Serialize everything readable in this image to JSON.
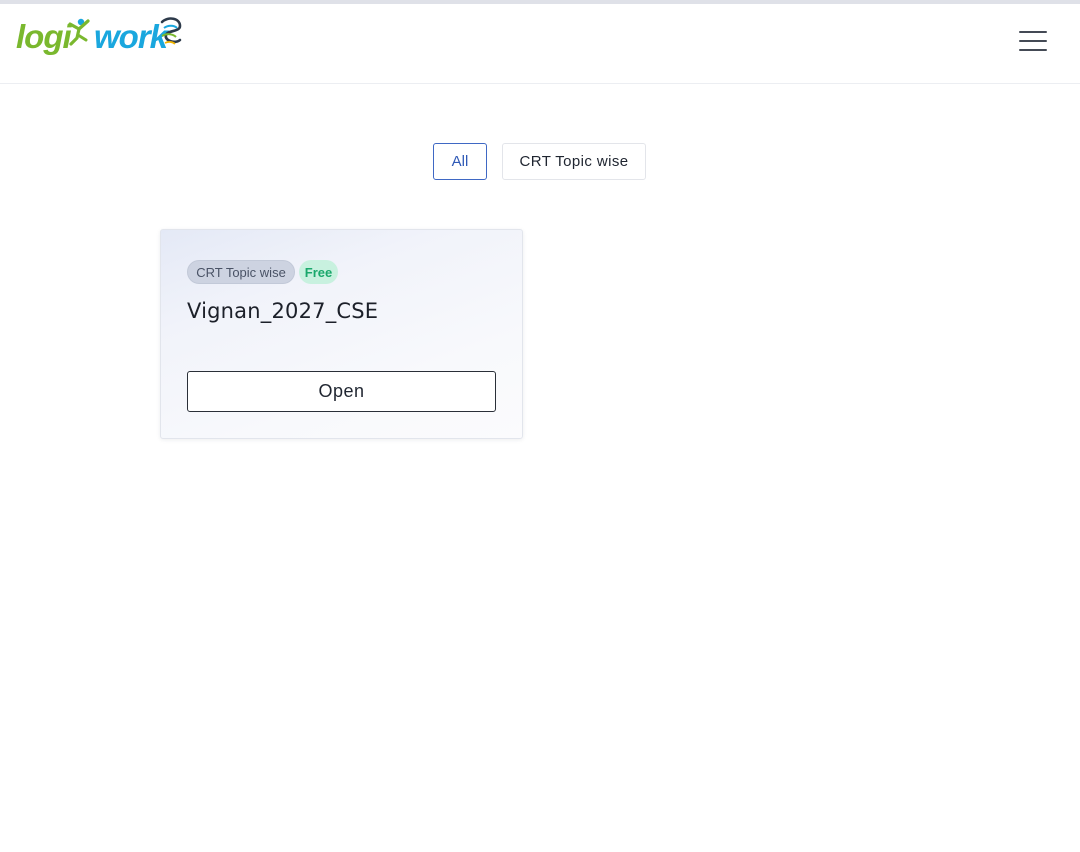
{
  "header": {
    "logo": {
      "text_logi": "logi",
      "text_work": "work",
      "icon": "runner-icon",
      "colors": {
        "green": "#7ab82e",
        "blue": "#1aa7de"
      }
    },
    "menu_icon": "hamburger-menu-icon"
  },
  "filters": {
    "items": [
      {
        "label": "All",
        "active": true
      },
      {
        "label": "CRT Topic wise",
        "active": false
      }
    ],
    "active_color": "#3f68c4"
  },
  "cards": [
    {
      "category_badge": "CRT Topic wise",
      "price_badge": "Free",
      "title": "Vignan_2027_CSE",
      "action_label": "Open"
    }
  ],
  "colors": {
    "free_badge_text": "#1aa86c",
    "free_badge_bg": "#c8f1df",
    "category_badge_bg": "#cdd3e1"
  }
}
